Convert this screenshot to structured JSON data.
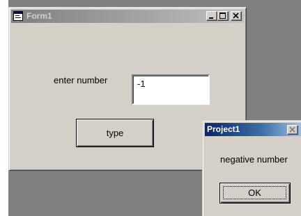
{
  "form1": {
    "title": "Form1",
    "label": "enter number",
    "input_value": "-1",
    "type_button": "type"
  },
  "message_box": {
    "title": "Project1",
    "message": "negative number",
    "ok_button": "OK"
  },
  "icons": {
    "form_icon": "form-window-icon",
    "minimize": "minimize-icon",
    "maximize": "maximize-icon",
    "close": "close-icon"
  },
  "colors": {
    "face": "#d4d0c8",
    "desktop": "#808080",
    "inactive_caption": "#808080",
    "active_caption": "#0a246a",
    "active_caption_gradient": "#a6caf0"
  }
}
